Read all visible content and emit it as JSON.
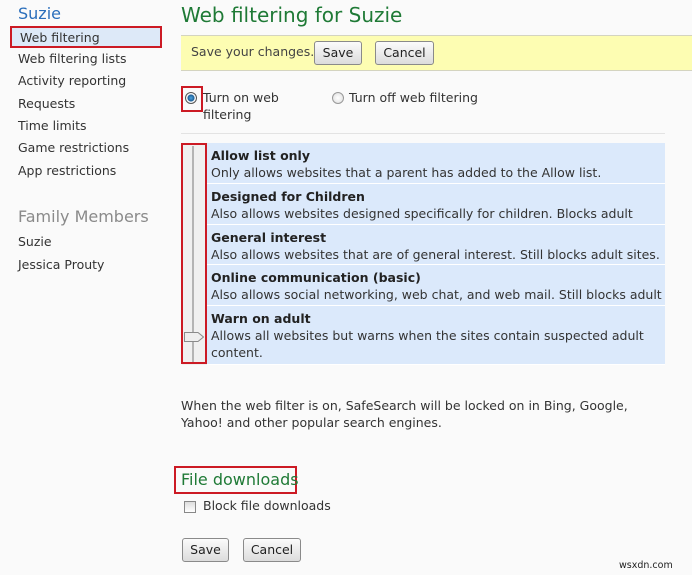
{
  "sidebar": {
    "title": "Suzie",
    "items": [
      {
        "label": "Web filtering",
        "active": true
      },
      {
        "label": "Web filtering lists"
      },
      {
        "label": "Activity reporting"
      },
      {
        "label": "Requests"
      },
      {
        "label": "Time limits"
      },
      {
        "label": "Game restrictions"
      },
      {
        "label": "App restrictions"
      }
    ],
    "family_title": "Family Members",
    "family": [
      {
        "label": "Suzie"
      },
      {
        "label": "Jessica Prouty"
      }
    ]
  },
  "main": {
    "title": "Web filtering for Suzie",
    "save_bar": {
      "text": "Save your changes.",
      "save_label": "Save",
      "cancel_label": "Cancel"
    },
    "filter_toggle": {
      "on_label_line1": "Turn on web",
      "on_label_line2": "filtering",
      "off_label": "Turn off web filtering",
      "selected": "on"
    },
    "levels": [
      {
        "title": "Allow list only",
        "desc": "Only allows websites that a parent has added to the Allow list."
      },
      {
        "title": "Designed for Children",
        "desc": "Also allows websites designed specifically for children. Blocks adult sites."
      },
      {
        "title": "General interest",
        "desc": "Also allows websites that are of general interest. Still blocks adult sites."
      },
      {
        "title": "Online communication (basic)",
        "desc": "Also allows social networking, web chat, and web mail. Still blocks adult sites."
      },
      {
        "title": "Warn on adult",
        "desc": "Allows all websites but warns when the sites contain suspected adult content."
      }
    ],
    "selected_level": "Warn on adult",
    "safesearch_note": "When the web filter is on, SafeSearch will be locked on in Bing, Google, Yahoo! and other popular search engines.",
    "file_downloads": {
      "title": "File downloads",
      "checkbox_label": "Block file downloads",
      "checked": false
    },
    "bottom_save_label": "Save",
    "bottom_cancel_label": "Cancel"
  },
  "watermark": "wsxdn.com"
}
